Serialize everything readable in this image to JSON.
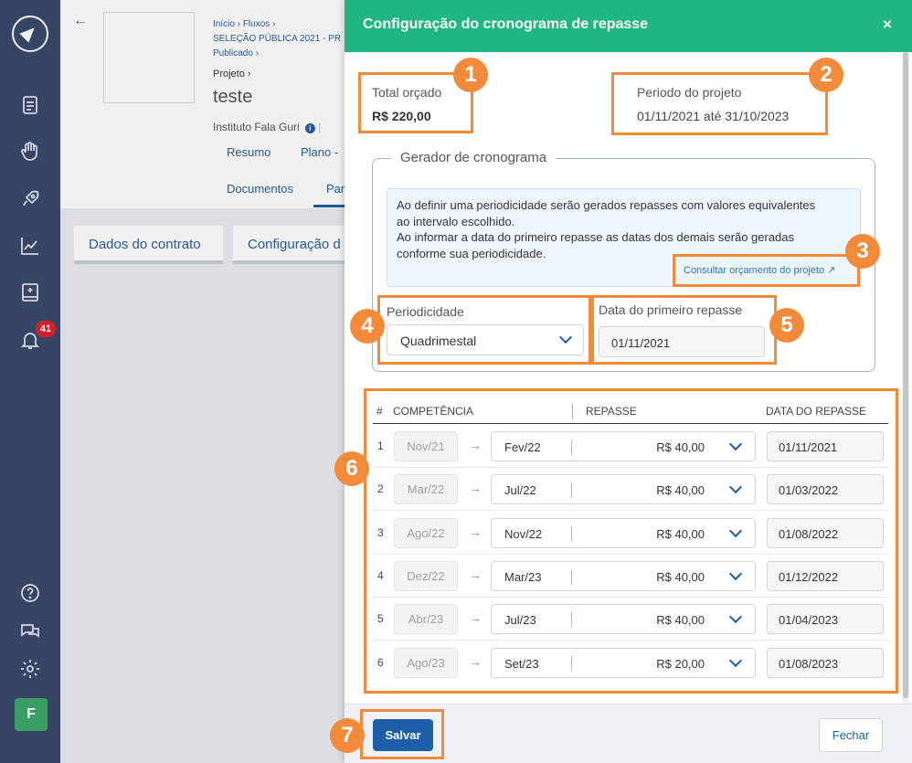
{
  "sidebar": {
    "notification_count": "41",
    "avatar_letter": "F"
  },
  "background": {
    "breadcrumb": [
      "Início",
      "Fluxos",
      "SELEÇÃO PÚBLICA 2021 - PR",
      "Publicado"
    ],
    "project_label": "Projeto",
    "project_title": "teste",
    "institution": "Instituto Fala Guri",
    "nav": [
      "Resumo",
      "Plano -",
      "Documentos",
      "Par"
    ],
    "tabs": [
      "Dados do contrato",
      "Configuração d"
    ]
  },
  "modal": {
    "title": "Configuração do cronograma de repasse",
    "close": "×",
    "total_label": "Total orçado",
    "total_value": "R$ 220,00",
    "period_label": "Periodo do projeto",
    "period_value": "01/11/2021 até 31/10/2023",
    "generator_title": "Gerador de cronograma",
    "info_lines": [
      "Ao definir uma periodicidade serão gerados repasses com valores equivalentes",
      "ao intervalo escolhido.",
      "Ao informar a data do primeiro repasse as datas dos demais serão geradas",
      "conforme sua periodicidade."
    ],
    "budget_link": "Consultar orçamento do projeto",
    "periodicity_label": "Periodicidade",
    "periodicity_value": "Quadrimestal",
    "first_date_label": "Data do primeiro repasse",
    "first_date_value": "01/11/2021",
    "table": {
      "headers": [
        "#",
        "COMPETÊNCIA",
        "REPASSE",
        "DATA DO REPASSE"
      ],
      "rows": [
        {
          "n": "1",
          "comp": "Nov/21",
          "month": "Fev/22",
          "value": "R$ 40,00",
          "date": "01/11/2021"
        },
        {
          "n": "2",
          "comp": "Mar/22",
          "month": "Jul/22",
          "value": "R$ 40,00",
          "date": "01/03/2022"
        },
        {
          "n": "3",
          "comp": "Ago/22",
          "month": "Nov/22",
          "value": "R$ 40,00",
          "date": "01/08/2022"
        },
        {
          "n": "4",
          "comp": "Dez/22",
          "month": "Mar/23",
          "value": "R$ 40,00",
          "date": "01/12/2022"
        },
        {
          "n": "5",
          "comp": "Abr/23",
          "month": "Jul/23",
          "value": "R$ 40,00",
          "date": "01/04/2023"
        },
        {
          "n": "6",
          "comp": "Ago/23",
          "month": "Set/23",
          "value": "R$ 20,00",
          "date": "01/08/2023"
        }
      ]
    },
    "save": "Salvar",
    "close_button": "Fechar"
  },
  "annotations": [
    "1",
    "2",
    "3",
    "4",
    "5",
    "6",
    "7"
  ],
  "colors": {
    "header": "#20b67f",
    "sidebar": "#3b4a6b",
    "annotation": "#f28a3a",
    "primary": "#1c5fa8"
  }
}
